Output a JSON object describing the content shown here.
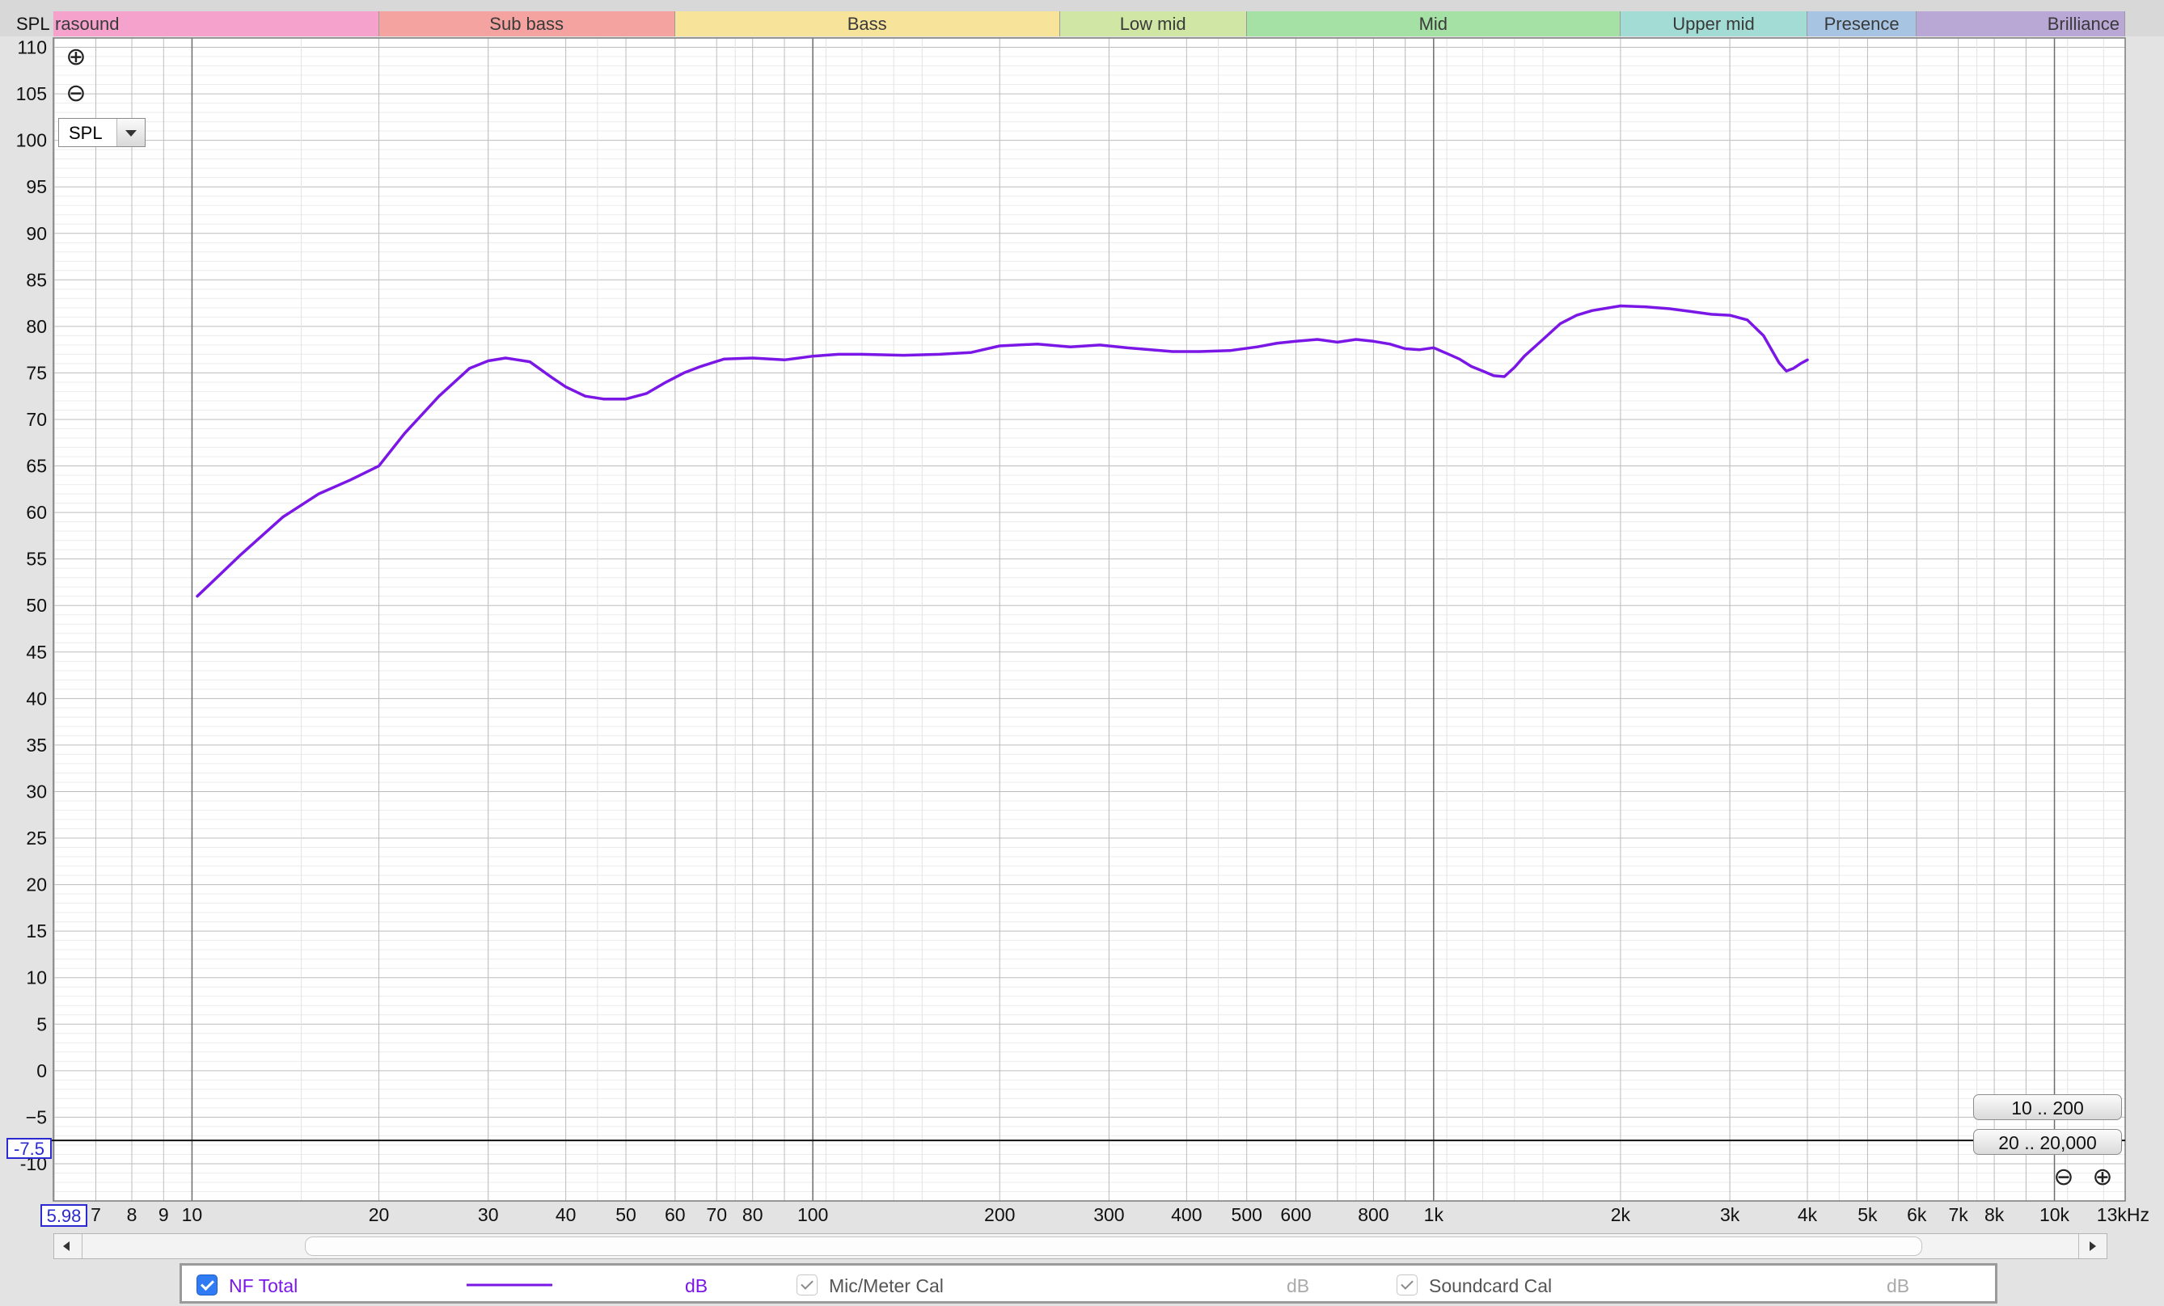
{
  "header": {
    "corner_label": "SPL"
  },
  "bands": [
    {
      "label": "rasound",
      "color": "#f5a3cc",
      "from": 5.98,
      "to": 20,
      "align": "left"
    },
    {
      "label": "Sub bass",
      "color": "#f4a3a0",
      "from": 20,
      "to": 60,
      "align": "center"
    },
    {
      "label": "Bass",
      "color": "#f7e49a",
      "from": 60,
      "to": 250,
      "align": "center"
    },
    {
      "label": "Low mid",
      "color": "#cfe6a4",
      "from": 250,
      "to": 500,
      "align": "center"
    },
    {
      "label": "Mid",
      "color": "#a5e0a5",
      "from": 500,
      "to": 2000,
      "align": "center"
    },
    {
      "label": "Upper mid",
      "color": "#a2dcd4",
      "from": 2000,
      "to": 4000,
      "align": "center"
    },
    {
      "label": "Presence",
      "color": "#a7c4e3",
      "from": 4000,
      "to": 6000,
      "align": "center"
    },
    {
      "label": "Brilliance",
      "color": "#b9a8d6",
      "from": 6000,
      "to": 13000,
      "align": "right"
    }
  ],
  "controls": {
    "measure_select": "SPL",
    "zoom_in_icon": "zoom-in-icon",
    "zoom_out_icon": "zoom-out-icon",
    "range_buttons": [
      "10 .. 200",
      "20 .. 20,000"
    ],
    "cursor_y_value": "-7.5",
    "cursor_x_value": "5.98"
  },
  "chart_data": {
    "type": "line",
    "xscale": "log",
    "xlim": [
      5.98,
      13000
    ],
    "ylim": [
      -14,
      111
    ],
    "xlabel": "",
    "ylabel": "",
    "grid": true,
    "y_ticks": [
      110,
      105,
      100,
      95,
      90,
      85,
      80,
      75,
      70,
      65,
      60,
      55,
      50,
      45,
      40,
      35,
      30,
      25,
      20,
      15,
      10,
      5,
      0,
      -5,
      -10
    ],
    "y_tick_labels": [
      "110",
      "105",
      "100",
      "95",
      "90",
      "85",
      "80",
      "75",
      "70",
      "65",
      "60",
      "55",
      "50",
      "45",
      "40",
      "35",
      "30",
      "25",
      "20",
      "15",
      "10",
      "5",
      "0",
      "−5",
      "-10"
    ],
    "x_ticks": [
      {
        "v": 7,
        "label": "7"
      },
      {
        "v": 8,
        "label": "8"
      },
      {
        "v": 9,
        "label": "9"
      },
      {
        "v": 10,
        "label": "10"
      },
      {
        "v": 20,
        "label": "20"
      },
      {
        "v": 30,
        "label": "30"
      },
      {
        "v": 40,
        "label": "40"
      },
      {
        "v": 50,
        "label": "50"
      },
      {
        "v": 60,
        "label": "60"
      },
      {
        "v": 70,
        "label": "70"
      },
      {
        "v": 80,
        "label": "80"
      },
      {
        "v": 100,
        "label": "100"
      },
      {
        "v": 200,
        "label": "200"
      },
      {
        "v": 300,
        "label": "300"
      },
      {
        "v": 400,
        "label": "400"
      },
      {
        "v": 500,
        "label": "500"
      },
      {
        "v": 600,
        "label": "600"
      },
      {
        "v": 800,
        "label": "800"
      },
      {
        "v": 1000,
        "label": "1k"
      },
      {
        "v": 2000,
        "label": "2k"
      },
      {
        "v": 3000,
        "label": "3k"
      },
      {
        "v": 4000,
        "label": "4k"
      },
      {
        "v": 5000,
        "label": "5k"
      },
      {
        "v": 6000,
        "label": "6k"
      },
      {
        "v": 7000,
        "label": "7k"
      },
      {
        "v": 8000,
        "label": "8k"
      },
      {
        "v": 10000,
        "label": "10k"
      },
      {
        "v": 13000,
        "label": "13kHz"
      }
    ],
    "cursor": {
      "y": -7.5
    },
    "series": [
      {
        "name": "NF Total",
        "color": "#7a17e6",
        "x": [
          10.2,
          12,
          14,
          16,
          18,
          20,
          22,
          25,
          28,
          30,
          32,
          35,
          38,
          40,
          43,
          46,
          50,
          54,
          58,
          62,
          66,
          72,
          80,
          90,
          95,
          100,
          110,
          120,
          140,
          160,
          180,
          200,
          230,
          260,
          290,
          320,
          350,
          380,
          420,
          470,
          520,
          560,
          600,
          650,
          700,
          750,
          800,
          850,
          900,
          950,
          1000,
          1050,
          1100,
          1150,
          1200,
          1250,
          1300,
          1350,
          1400,
          1500,
          1600,
          1700,
          1800,
          2000,
          2200,
          2400,
          2600,
          2800,
          3000,
          3200,
          3400,
          3600,
          3700,
          3800,
          3900,
          4000
        ],
        "y": [
          51,
          55.5,
          59.5,
          62,
          63.5,
          65,
          68.5,
          72.5,
          75.5,
          76.3,
          76.6,
          76.2,
          74.5,
          73.5,
          72.5,
          72.2,
          72.2,
          72.8,
          74,
          75,
          75.7,
          76.5,
          76.6,
          76.4,
          76.6,
          76.8,
          77,
          77,
          76.9,
          77,
          77.2,
          77.9,
          78.1,
          77.8,
          78,
          77.7,
          77.5,
          77.3,
          77.3,
          77.4,
          77.8,
          78.2,
          78.4,
          78.6,
          78.3,
          78.6,
          78.4,
          78.1,
          77.6,
          77.5,
          77.7,
          77.1,
          76.5,
          75.7,
          75.2,
          74.7,
          74.6,
          75.6,
          76.8,
          78.6,
          80.3,
          81.2,
          81.7,
          82.2,
          82.1,
          81.9,
          81.6,
          81.3,
          81.2,
          80.7,
          79.0,
          76.1,
          75.2,
          75.5,
          76.0,
          76.4
        ]
      }
    ]
  },
  "legend": {
    "items": [
      {
        "label": "NF Total",
        "unit": "dB",
        "checked": true,
        "active": true
      },
      {
        "label": "Mic/Meter Cal",
        "unit": "dB",
        "checked": true,
        "active": false
      },
      {
        "label": "Soundcard Cal",
        "unit": "dB",
        "checked": true,
        "active": false
      }
    ]
  }
}
